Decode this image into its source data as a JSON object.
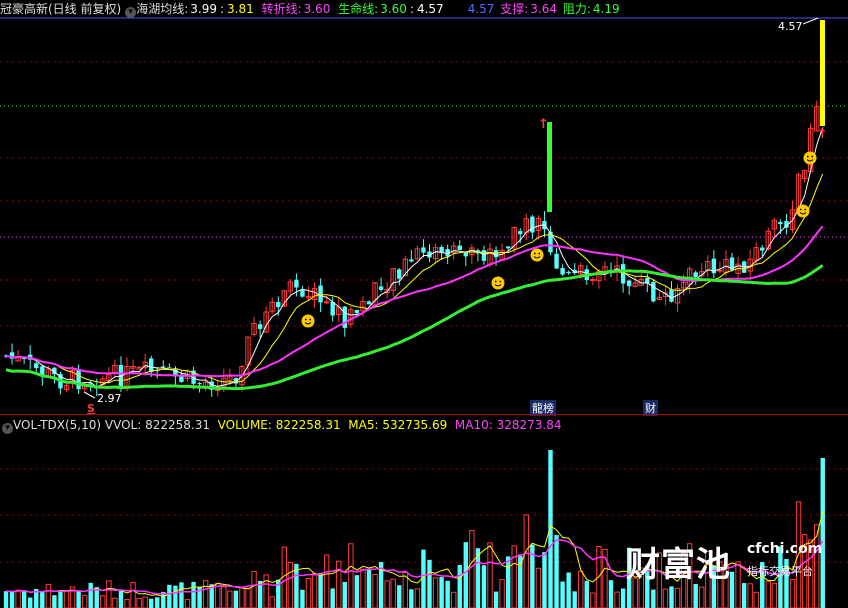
{
  "header_upper": {
    "stock_title": "冠豪高新(日线 前复权)",
    "indicator_name": "海湖均线",
    "ma_value_1": "3.99",
    "ma_value_2": "3.81",
    "turn_label": "转折线:",
    "turn_value": "3.60",
    "life_label": "生命线:",
    "life_value": "3.60",
    "extra_value": "4.57",
    "right_value": "4.57",
    "support_label": "支撑:",
    "support_value": "3.64",
    "resist_label": "阻力:",
    "resist_value": "4.19"
  },
  "header_lower": {
    "indicator_name": "VOL-TDX(5,10)",
    "vvol_label": "VVOL:",
    "vvol_value": "822258.31",
    "volume_label": "VOLUME:",
    "volume_value": "822258.31",
    "ma5_label": "MA5:",
    "ma5_value": "532735.69",
    "ma10_label": "MA10:",
    "ma10_value": "328273.84"
  },
  "price_labels": {
    "high_price": "4.57",
    "low_price": "2.97"
  },
  "chart_tags": {
    "tag_s": "S",
    "tag_list": "榜",
    "tag_list_marker": "龍",
    "tag_cai": "财"
  },
  "watermark": {
    "brand": "财富池",
    "url": "cfchi.com",
    "sub": "指标交易平台"
  },
  "colors": {
    "background": "#000000",
    "up_candle": "#ff3b3b",
    "down_candle": "#54ffff",
    "ma_white": "#ffffff",
    "ma_yellow": "#ffff00",
    "ma_magenta": "#ff33ff",
    "ma_green": "#33ee33",
    "grid_red": "#8b0000",
    "support_dots": "#ff44ff",
    "resist_dots": "#33ff33",
    "label_green": "#33ff33",
    "label_magenta": "#ff44ff",
    "label_yellow": "#ffff00",
    "label_blue": "#5566ff"
  }
}
